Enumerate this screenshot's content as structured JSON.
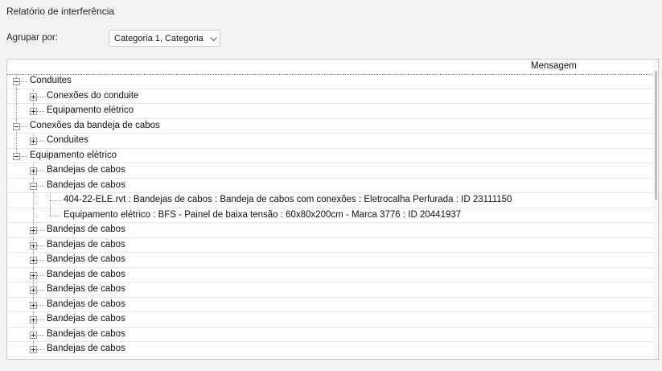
{
  "window": {
    "title": "Relatório de interferência"
  },
  "group_by": {
    "label": "Agrupar por:",
    "value": "Categoria 1, Categoria"
  },
  "tree": {
    "column_header": "Mensagem",
    "rows": [
      {
        "level": 0,
        "expander": "minus",
        "label": "Conduites"
      },
      {
        "level": 1,
        "expander": "plus",
        "label": "Conexões do conduite"
      },
      {
        "level": 1,
        "expander": "plus",
        "label": "Equipamento elétrico"
      },
      {
        "level": 0,
        "expander": "minus",
        "label": "Conexões da bandeja de cabos"
      },
      {
        "level": 1,
        "expander": "plus",
        "label": "Conduites"
      },
      {
        "level": 0,
        "expander": "minus",
        "label": "Equipamento elétrico"
      },
      {
        "level": 1,
        "expander": "plus",
        "label": "Bandejas de cabos"
      },
      {
        "level": 1,
        "expander": "minus",
        "label": "Bandejas de cabos"
      },
      {
        "level": 2,
        "expander": "none",
        "label": "404-22-ELE.rvt : Bandejas de cabos : Bandeja de cabos com conexões : Eletrocalha Perfurada : ID 23111150"
      },
      {
        "level": 2,
        "expander": "none",
        "label": "Equipamento elétrico : BFS - Painel de baixa tensão : 60x80x200cm - Marca 3776 : ID 20441937"
      },
      {
        "level": 1,
        "expander": "plus",
        "label": "Bandejas de cabos"
      },
      {
        "level": 1,
        "expander": "plus",
        "label": "Bandejas de cabos"
      },
      {
        "level": 1,
        "expander": "plus",
        "label": "Bandejas de cabos"
      },
      {
        "level": 1,
        "expander": "plus",
        "label": "Bandejas de cabos"
      },
      {
        "level": 1,
        "expander": "plus",
        "label": "Bandejas de cabos"
      },
      {
        "level": 1,
        "expander": "plus",
        "label": "Bandejas de cabos"
      },
      {
        "level": 1,
        "expander": "plus",
        "label": "Bandejas de cabos"
      },
      {
        "level": 1,
        "expander": "plus",
        "label": "Bandejas de cabos"
      },
      {
        "level": 1,
        "expander": "plus",
        "label": "Bandejas de cabos"
      }
    ]
  }
}
